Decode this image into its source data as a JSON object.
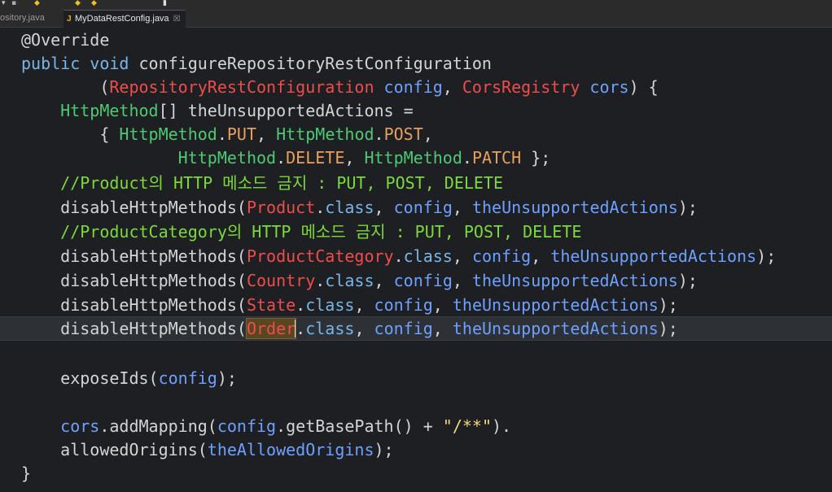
{
  "tabs": [
    {
      "label": "ository.java",
      "active": false
    },
    {
      "label": "MyDataRestConfig.java",
      "active": true,
      "close": "☒"
    }
  ],
  "code": {
    "l1": {
      "ann": "@Override"
    },
    "l2": {
      "kw": "public void ",
      "name": "configureRepositoryRestConfiguration"
    },
    "l3": {
      "open": "(",
      "t1": "RepositoryRestConfiguration",
      "p1": " config",
      "comma": ", ",
      "t2": "CorsRegistry",
      "p2": " cors",
      "close": ") {"
    },
    "l4": {
      "type": "HttpMethod",
      "rest": "[] ",
      "name": "theUnsupportedActions",
      "eq": " ="
    },
    "l5": {
      "brace": "{ ",
      "t1": "HttpMethod",
      "d1": ".",
      "f1": "PUT",
      "c1": ", ",
      "t2": "HttpMethod",
      "d2": ".",
      "f2": "POST",
      "c2": ","
    },
    "l6": {
      "t1": "HttpMethod",
      "d1": ".",
      "f1": "DELETE",
      "c1": ", ",
      "t2": "HttpMethod",
      "d2": ".",
      "f2": "PATCH",
      "end": " };"
    },
    "l7": {
      "comment": "//Product의 HTTP 메소드 금지 : PUT, POST, DELETE"
    },
    "l8": {
      "fn": "disableHttpMethods(",
      "cls": "Product",
      "dot": ".",
      "kwc": "class",
      "c1": ", ",
      "a1": "config",
      "c2": ", ",
      "a2": "theUnsupportedActions",
      "end": ");"
    },
    "l9": {
      "comment": "//ProductCategory의 HTTP 메소드 금지 : PUT, POST, DELETE"
    },
    "l10": {
      "fn": "disableHttpMethods(",
      "cls": "ProductCategory",
      "dot": ".",
      "kwc": "class",
      "c1": ", ",
      "a1": "config",
      "c2": ", ",
      "a2": "theUnsupportedActions",
      "end": ");"
    },
    "l11": {
      "fn": "disableHttpMethods(",
      "cls": "Country",
      "dot": ".",
      "kwc": "class",
      "c1": ", ",
      "a1": "config",
      "c2": ", ",
      "a2": "theUnsupportedActions",
      "end": ");"
    },
    "l12": {
      "fn": "disableHttpMethods(",
      "cls": "State",
      "dot": ".",
      "kwc": "class",
      "c1": ", ",
      "a1": "config",
      "c2": ", ",
      "a2": "theUnsupportedActions",
      "end": ");"
    },
    "l13": {
      "fn": "disableHttpMethods(",
      "cls": "Order",
      "dot": ".",
      "kwc": "class",
      "c1": ", ",
      "a1": "config",
      "c2": ", ",
      "a2": "theUnsupportedActions",
      "end": ");"
    },
    "l15": {
      "fn": "exposeIds(",
      "a1": "config",
      "end": ");"
    },
    "l17": {
      "v": "cors",
      "m": ".addMapping(",
      "a1": "config",
      "m2": ".getBasePath() + ",
      "s": "\"/**\"",
      "end": ")."
    },
    "l18": {
      "fn": "allowedOrigins(",
      "a1": "theAllowedOrigins",
      "end": ");"
    },
    "l19": {
      "brace": "}"
    }
  }
}
